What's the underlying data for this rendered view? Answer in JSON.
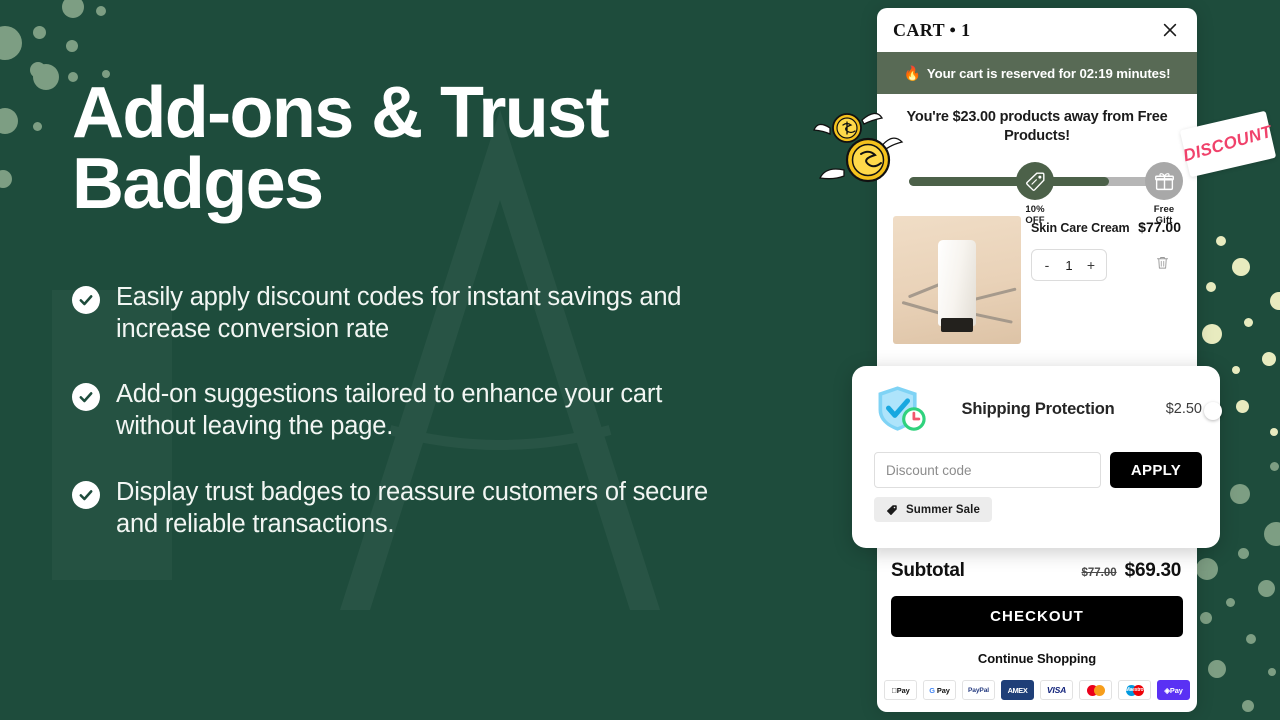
{
  "hero": {
    "title_line1": "Add-ons & Trust",
    "title_line2": "Badges",
    "bullets": [
      "Easily apply discount codes for instant savings and increase conversion rate",
      "Add-on suggestions tailored to enhance your cart without leaving the page.",
      "Display trust badges to reassure customers of secure and reliable transactions."
    ]
  },
  "decor": {
    "discount_sticker": "DISCOUNT",
    "coins_icon": "flying-coins-icon",
    "background_color": "#1e4c3c",
    "dot_sage": "#7d9e83",
    "dot_cream": "#e8ebbf"
  },
  "cart": {
    "title": "CART • 1",
    "close_icon": "close-icon",
    "reserve": {
      "flame_icon": "🔥",
      "text": "Your cart is reserved for 02:19 minutes!",
      "banner_color": "#586a55"
    },
    "progress": {
      "message": "You're $23.00 products away from Free Products!",
      "fill_percent": 78,
      "milestones": [
        {
          "icon": "discount-tag-icon",
          "label_line1": "10%",
          "label_line2": "OFF",
          "state": "active"
        },
        {
          "icon": "gift-icon",
          "label_line1": "Free",
          "label_line2": "Gift",
          "state": "inactive"
        }
      ]
    },
    "product": {
      "image_alt": "skin-care-cream-product-photo",
      "name": "Skin Care Cream",
      "price": "$77.00",
      "qty": "1",
      "minus_label": "-",
      "plus_label": "+",
      "remove_icon": "trash-icon"
    },
    "addon": {
      "icon": "shield-clock-icon",
      "name": "Shipping Protection",
      "price": "$2.50",
      "toggle_state": "off"
    },
    "discount": {
      "placeholder": "Discount code",
      "value": "",
      "apply_label": "APPLY",
      "chip_icon": "tag-icon",
      "chip_label": "Summer Sale"
    },
    "footer": {
      "subtotal_label": "Subtotal",
      "original_price": "$77.00",
      "discounted_price": "$69.30",
      "checkout_label": "CHECKOUT",
      "continue_label": "Continue Shopping",
      "payment_methods": [
        {
          "name": "apple-pay",
          "label": "Pay"
        },
        {
          "name": "google-pay",
          "label": "Pay"
        },
        {
          "name": "paypal",
          "label": "PayPal"
        },
        {
          "name": "amex",
          "label": "AMEX"
        },
        {
          "name": "visa",
          "label": "VISA"
        },
        {
          "name": "mastercard",
          "label": ""
        },
        {
          "name": "maestro",
          "label": "Maestro"
        },
        {
          "name": "shop-pay",
          "label": "Pay"
        }
      ]
    }
  }
}
